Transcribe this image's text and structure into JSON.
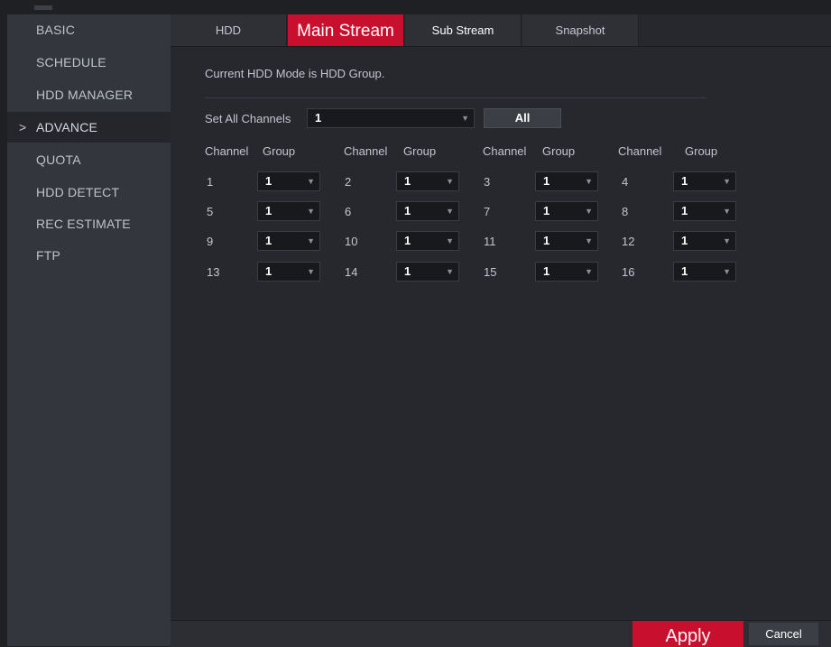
{
  "sidebar": {
    "items": [
      {
        "label": "BASIC"
      },
      {
        "label": "SCHEDULE"
      },
      {
        "label": "HDD MANAGER"
      },
      {
        "label": "ADVANCE",
        "active": true
      },
      {
        "label": "QUOTA"
      },
      {
        "label": "HDD DETECT"
      },
      {
        "label": "REC ESTIMATE"
      },
      {
        "label": "FTP"
      }
    ],
    "active_marker": ">"
  },
  "tabs": [
    {
      "label": "HDD"
    },
    {
      "label": "Main Stream",
      "active": true
    },
    {
      "label": "Sub Stream"
    },
    {
      "label": "Snapshot"
    }
  ],
  "main": {
    "message": "Current HDD Mode is HDD Group.",
    "set_all_label": "Set All Channels",
    "set_all_value": "1",
    "all_button": "All",
    "headers": {
      "channel": "Channel",
      "group": "Group"
    },
    "rows": [
      [
        {
          "channel": "1",
          "group": "1"
        },
        {
          "channel": "2",
          "group": "1"
        },
        {
          "channel": "3",
          "group": "1"
        },
        {
          "channel": "4",
          "group": "1"
        }
      ],
      [
        {
          "channel": "5",
          "group": "1"
        },
        {
          "channel": "6",
          "group": "1"
        },
        {
          "channel": "7",
          "group": "1"
        },
        {
          "channel": "8",
          "group": "1"
        }
      ],
      [
        {
          "channel": "9",
          "group": "1"
        },
        {
          "channel": "10",
          "group": "1"
        },
        {
          "channel": "11",
          "group": "1"
        },
        {
          "channel": "12",
          "group": "1"
        }
      ],
      [
        {
          "channel": "13",
          "group": "1"
        },
        {
          "channel": "14",
          "group": "1"
        },
        {
          "channel": "15",
          "group": "1"
        },
        {
          "channel": "16",
          "group": "1"
        }
      ]
    ],
    "dropdown_arrow": "▼"
  },
  "footer": {
    "apply": "Apply",
    "cancel": "Cancel"
  },
  "colors": {
    "accent": "#c8102e",
    "sidebar_bg": "#33363d",
    "content_bg": "#27282e"
  }
}
